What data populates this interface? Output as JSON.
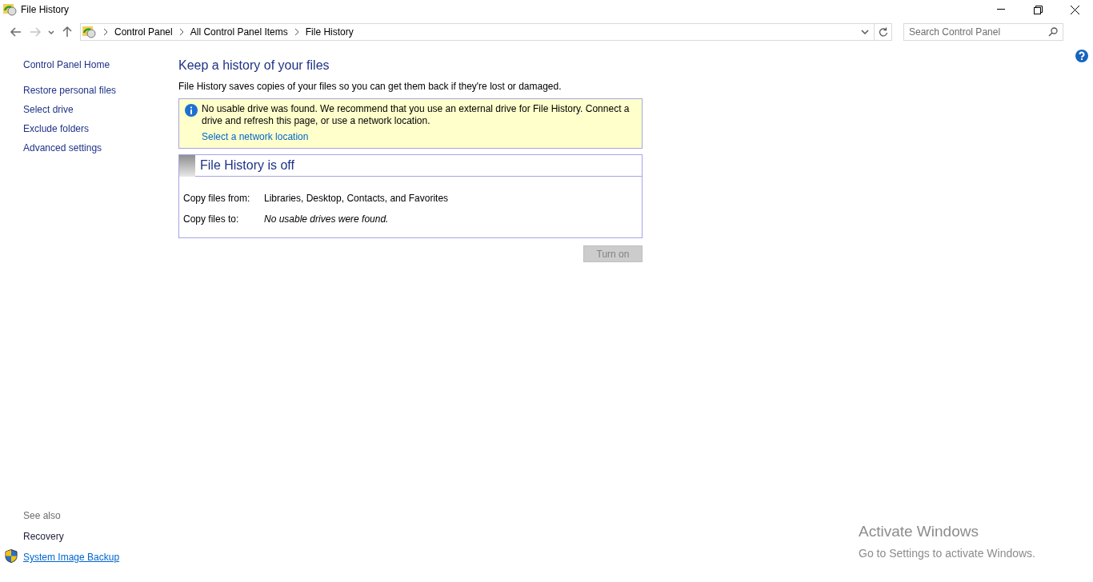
{
  "window": {
    "title": "File History"
  },
  "navigation": {
    "buttons": [
      {
        "kind": "back",
        "disabled": false
      },
      {
        "kind": "forward",
        "disabled": true
      },
      {
        "kind": "recent",
        "disabled": false
      },
      {
        "kind": "up",
        "disabled": false
      }
    ],
    "breadcrumbs": [
      "Control Panel",
      "All Control Panel Items",
      "File History"
    ],
    "search": {
      "placeholder": "Search Control Panel"
    }
  },
  "sidebar": {
    "home": "Control Panel Home",
    "items": [
      "Restore personal files",
      "Select drive",
      "Exclude folders",
      "Advanced settings"
    ],
    "see_also": {
      "heading": "See also",
      "items": [
        {
          "label": "Recovery",
          "kind": "plain"
        },
        {
          "label": "System Image Backup",
          "kind": "shield"
        }
      ]
    }
  },
  "main": {
    "title": "Keep a history of your files",
    "description": "File History saves copies of your files so you can get them back if they're lost or damaged.",
    "notice": {
      "message": "No usable drive was found. We recommend that you use an external drive for File History. Connect a drive and refresh this page, or use a network location.",
      "link": "Select a network location"
    },
    "status": {
      "title": "File History is off",
      "rows": [
        {
          "label": "Copy files from:",
          "value": "Libraries, Desktop, Contacts, and Favorites",
          "italic": false
        },
        {
          "label": "Copy files to:",
          "value": "No usable drives were found.",
          "italic": true
        }
      ]
    },
    "button": {
      "label": "Turn on",
      "disabled": true
    }
  },
  "activation": {
    "title": "Activate Windows",
    "message": "Go to Settings to activate Windows."
  }
}
